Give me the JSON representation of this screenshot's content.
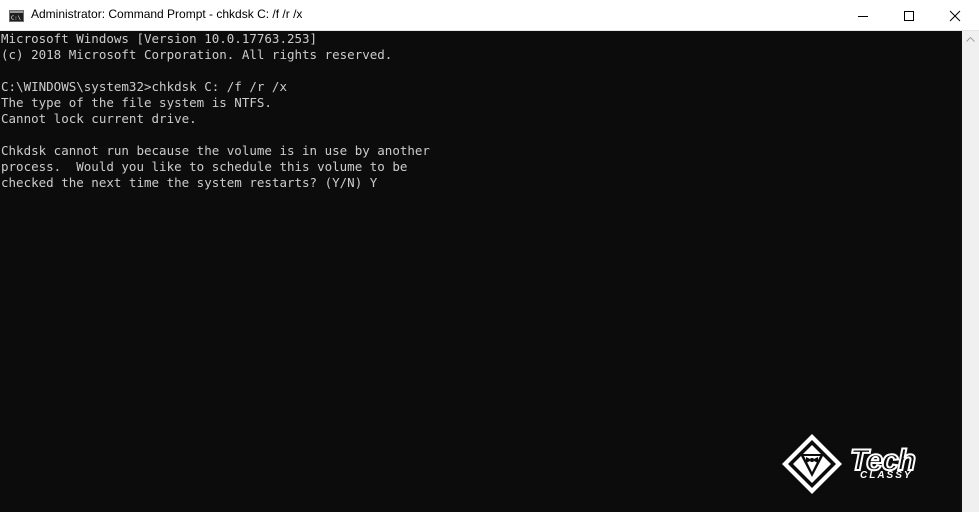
{
  "window": {
    "title": "Administrator: Command Prompt - chkdsk  C: /f /r /x",
    "icon": "cmd-icon",
    "controls": {
      "minimize": "minimize-icon",
      "maximize": "maximize-icon",
      "close": "close-icon"
    }
  },
  "console": {
    "lines": [
      "Microsoft Windows [Version 10.0.17763.253]",
      "(c) 2018 Microsoft Corporation. All rights reserved.",
      "",
      "C:\\WINDOWS\\system32>chkdsk C: /f /r /x",
      "The type of the file system is NTFS.",
      "Cannot lock current drive.",
      "",
      "Chkdsk cannot run because the volume is in use by another",
      "process.  Would you like to schedule this volume to be",
      "checked the next time the system restarts? (Y/N) Y"
    ],
    "text_color": "#cccccc",
    "background_color": "#0c0c0c"
  },
  "watermark": {
    "word_main": "Tech",
    "word_sub": "CLASSY"
  }
}
